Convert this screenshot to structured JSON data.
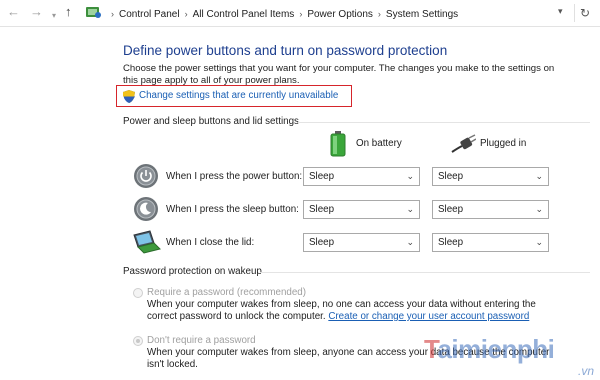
{
  "address_bar": {
    "back_icon": "arrow-left-icon",
    "forward_icon": "arrow-right-icon",
    "dropdown_icon": "chevron-down-icon",
    "up_icon": "arrow-up-icon",
    "breadcrumb": [
      "Control Panel",
      "All Control Panel Items",
      "Power Options",
      "System Settings"
    ],
    "refresh_icon": "refresh-icon"
  },
  "page": {
    "title": "Define power buttons and turn on password protection",
    "description": "Choose the power settings that you want for your computer. The changes you make to the settings on this page apply to all of your power plans.",
    "change_settings_link": "Change settings that are currently unavailable"
  },
  "buttons_section": {
    "heading": "Power and sleep buttons and lid settings",
    "col_battery": "On battery",
    "col_plugged": "Plugged in",
    "rows": [
      {
        "label": "When I press the power button:",
        "icon": "power-button-icon",
        "on_battery": "Sleep",
        "plugged_in": "Sleep"
      },
      {
        "label": "When I press the sleep button:",
        "icon": "sleep-moon-icon",
        "on_battery": "Sleep",
        "plugged_in": "Sleep"
      },
      {
        "label": "When I close the lid:",
        "icon": "laptop-lid-icon",
        "on_battery": "Sleep",
        "plugged_in": "Sleep"
      }
    ]
  },
  "password_section": {
    "heading": "Password protection on wakeup",
    "options": [
      {
        "label": "Require a password (recommended)",
        "selected": false,
        "desc_before": "When your computer wakes from sleep, no one can access your data without entering the correct password to unlock the computer. ",
        "link": "Create or change your user account password"
      },
      {
        "label": "Don't require a password",
        "selected": true,
        "desc_before": "When your computer wakes from sleep, anyone can access your data because the computer isn't locked."
      }
    ]
  },
  "watermark": {
    "brand_t": "T",
    "brand_rest": "aimienphi",
    "suffix": ".vn"
  },
  "colors": {
    "title": "#1e3f8f",
    "link": "#1a5fb4",
    "highlight_border": "#d6252b"
  }
}
